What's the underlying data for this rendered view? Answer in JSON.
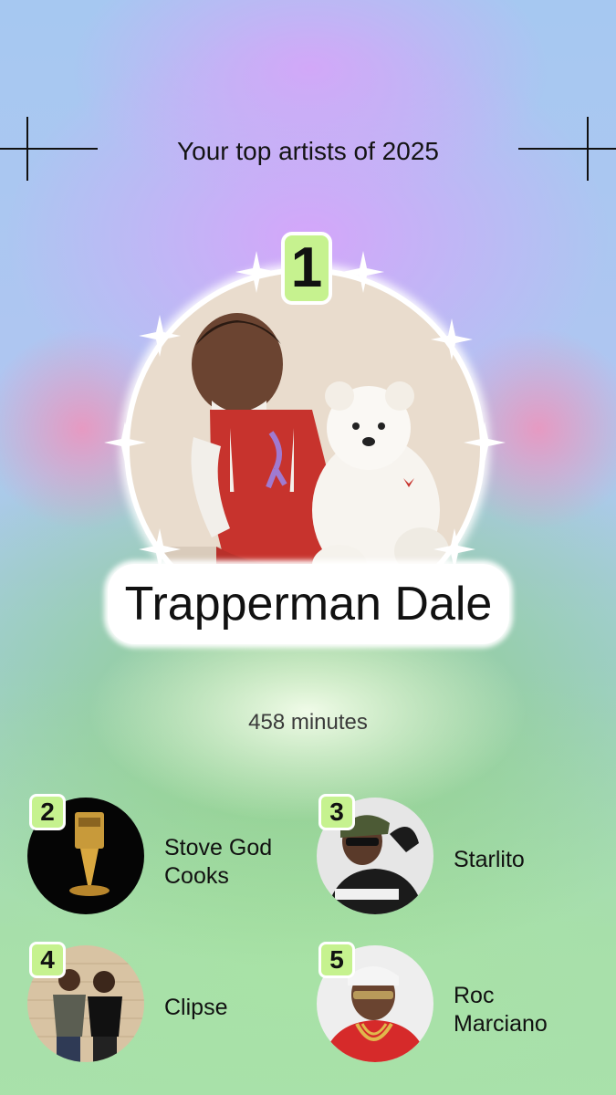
{
  "header": {
    "title": "Your top artists of 2025"
  },
  "top_artist": {
    "rank": "1",
    "name": "Trapperman Dale",
    "minutes": "458 minutes"
  },
  "others": [
    {
      "rank": "2",
      "name": "Stove God Cooks"
    },
    {
      "rank": "3",
      "name": "Starlito"
    },
    {
      "rank": "4",
      "name": "Clipse"
    },
    {
      "rank": "5",
      "name": "Roc Marciano"
    }
  ],
  "colors": {
    "badge": "#c6f28f",
    "text": "#111111"
  }
}
